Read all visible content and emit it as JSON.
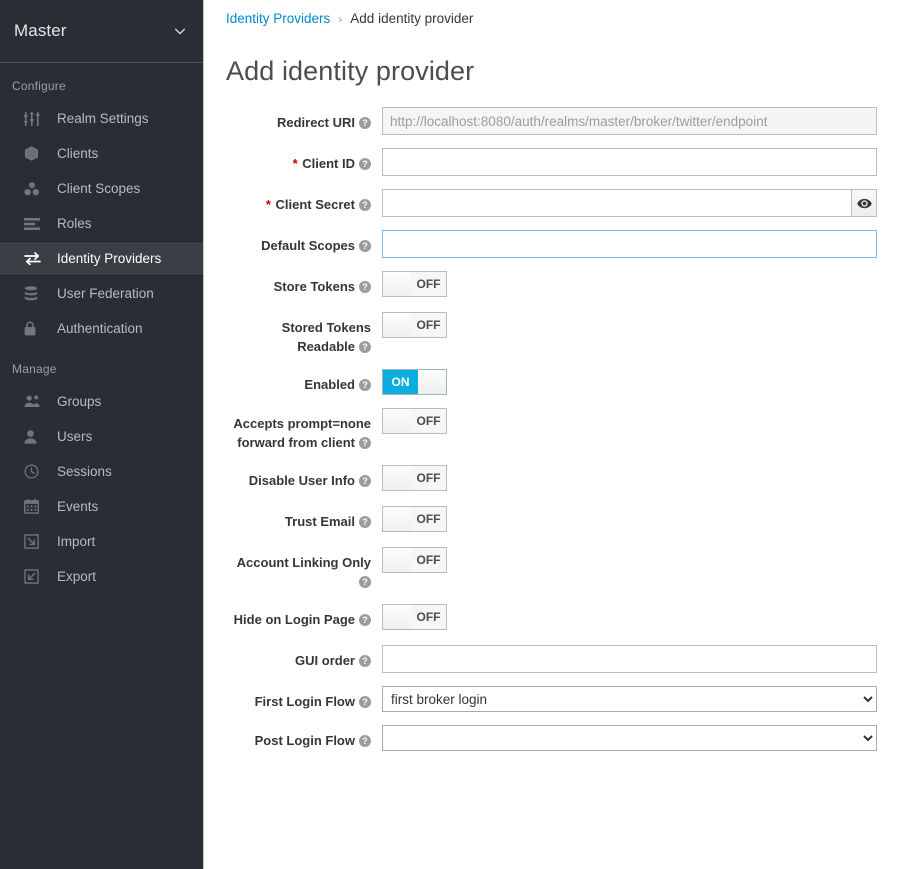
{
  "sidebar": {
    "realm": {
      "name": "Master",
      "caret_icon": "chevron-down-icon"
    },
    "sections": [
      {
        "label": "Configure",
        "items": [
          {
            "label": "Realm Settings",
            "icon": "sliders-icon",
            "active": false
          },
          {
            "label": "Clients",
            "icon": "cube-icon",
            "active": false
          },
          {
            "label": "Client Scopes",
            "icon": "blocks-icon",
            "active": false
          },
          {
            "label": "Roles",
            "icon": "list-bars-icon",
            "active": false
          },
          {
            "label": "Identity Providers",
            "icon": "exchange-arrows-icon",
            "active": true
          },
          {
            "label": "User Federation",
            "icon": "database-icon",
            "active": false
          },
          {
            "label": "Authentication",
            "icon": "lock-icon",
            "active": false
          }
        ]
      },
      {
        "label": "Manage",
        "items": [
          {
            "label": "Groups",
            "icon": "users-group-icon",
            "active": false
          },
          {
            "label": "Users",
            "icon": "user-icon",
            "active": false
          },
          {
            "label": "Sessions",
            "icon": "clock-icon",
            "active": false
          },
          {
            "label": "Events",
            "icon": "calendar-icon",
            "active": false
          },
          {
            "label": "Import",
            "icon": "import-arrow-icon",
            "active": false
          },
          {
            "label": "Export",
            "icon": "export-arrow-icon",
            "active": false
          }
        ]
      }
    ]
  },
  "breadcrumb": {
    "parent": "Identity Providers",
    "separator": "›",
    "current": "Add identity provider"
  },
  "page": {
    "title": "Add identity provider"
  },
  "form": {
    "help_glyph": "?",
    "required_marker": "*",
    "rows": [
      {
        "label": "Redirect URI",
        "type": "text",
        "value": "",
        "placeholder": "http://localhost:8080/auth/realms/master/broker/twitter/endpoint",
        "readonly": true,
        "required": false,
        "focused": false
      },
      {
        "label": "Client ID",
        "type": "text",
        "value": "",
        "placeholder": "",
        "readonly": false,
        "required": true,
        "focused": false
      },
      {
        "label": "Client Secret",
        "type": "secret",
        "value": "",
        "placeholder": "",
        "readonly": false,
        "required": true,
        "focused": false,
        "reveal_icon": "eye-icon"
      },
      {
        "label": "Default Scopes",
        "type": "text",
        "value": "",
        "placeholder": "",
        "readonly": false,
        "required": false,
        "focused": true
      },
      {
        "label": "Store Tokens",
        "type": "toggle",
        "state": "OFF"
      },
      {
        "label": "Stored Tokens Readable",
        "type": "toggle",
        "state": "OFF"
      },
      {
        "label": "Enabled",
        "type": "toggle",
        "state": "ON"
      },
      {
        "label": "Accepts prompt=none forward from client",
        "type": "toggle",
        "state": "OFF"
      },
      {
        "label": "Disable User Info",
        "type": "toggle",
        "state": "OFF"
      },
      {
        "label": "Trust Email",
        "type": "toggle",
        "state": "OFF"
      },
      {
        "label": "Account Linking Only",
        "type": "toggle",
        "state": "OFF"
      },
      {
        "label": "Hide on Login Page",
        "type": "toggle",
        "state": "OFF"
      },
      {
        "label": "GUI order",
        "type": "text",
        "value": "",
        "placeholder": "",
        "readonly": false,
        "required": false,
        "focused": false
      },
      {
        "label": "First Login Flow",
        "type": "select",
        "value": "first broker login",
        "options": [
          "first broker login"
        ]
      },
      {
        "label": "Post Login Flow",
        "type": "select",
        "value": "",
        "options": [
          ""
        ]
      }
    ]
  },
  "colors": {
    "sidebar_bg": "#292e34",
    "sidebar_active_bg": "#393f44",
    "link": "#0088ce",
    "toggle_on": "#0bacde",
    "required": "#cc0000",
    "focus_border": "#7cb8e8"
  }
}
